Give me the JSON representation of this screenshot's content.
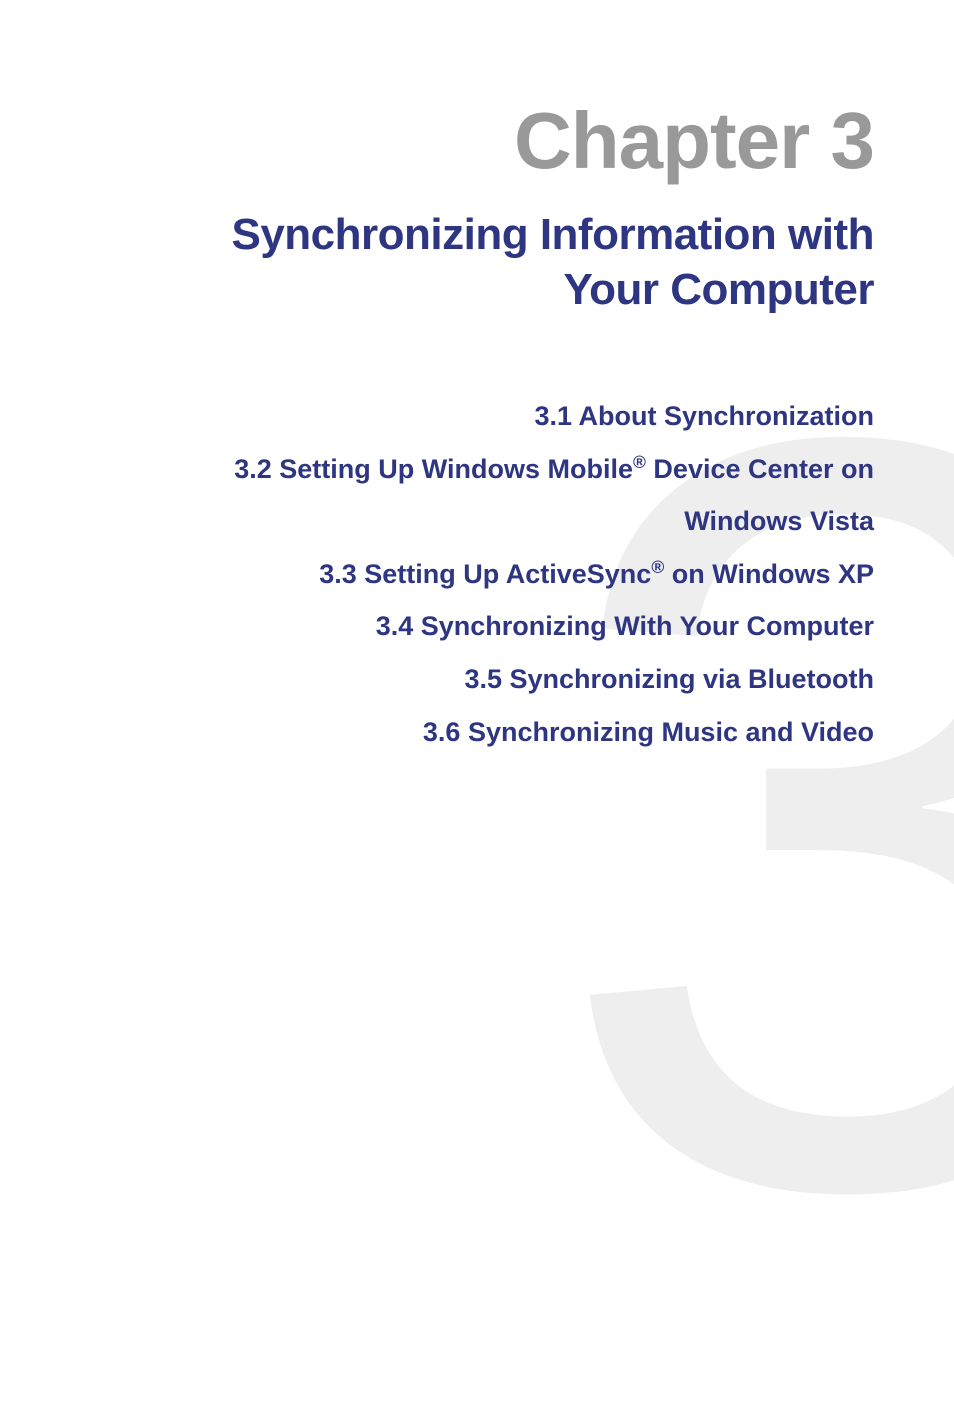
{
  "chapter": {
    "heading": "Chapter 3",
    "title_line1": "Synchronizing Information with",
    "title_line2": "Your Computer",
    "bg_number": "3"
  },
  "toc": {
    "item1": "3.1  About Synchronization",
    "item2_pre": "3.2  Setting Up Windows Mobile",
    "item2_post": " Device Center on",
    "item2_line2": "Windows Vista",
    "item3_pre": "3.3  Setting Up ActiveSync",
    "item3_post": " on Windows XP",
    "item4": "3.4  Synchronizing With Your Computer",
    "item5": "3.5  Synchronizing via Bluetooth",
    "item6": "3.6  Synchronizing Music and Video",
    "reg": "®"
  }
}
